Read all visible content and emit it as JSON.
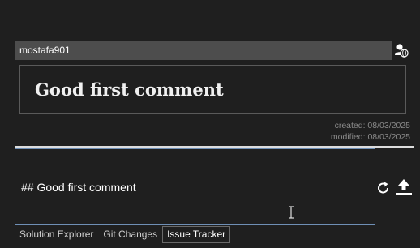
{
  "comment": {
    "author": "mostafa901",
    "rendered_heading": "Good first comment",
    "created": "created: 08/03/2025",
    "modified": "modified: 08/03/2025"
  },
  "editor": {
    "value": "## Good first comment"
  },
  "icons": {
    "avatar": "user-globe-icon",
    "refresh": "refresh-icon",
    "upload": "upload-icon",
    "cursor": "text-cursor-icon"
  },
  "tabs": [
    {
      "label": "Solution Explorer",
      "active": false
    },
    {
      "label": "Git Changes",
      "active": false
    },
    {
      "label": "Issue Tracker",
      "active": true
    }
  ],
  "colors": {
    "background": "#1f1f1f",
    "author_bar": "#4d4d4d",
    "editor_border": "#6f8fb5"
  }
}
